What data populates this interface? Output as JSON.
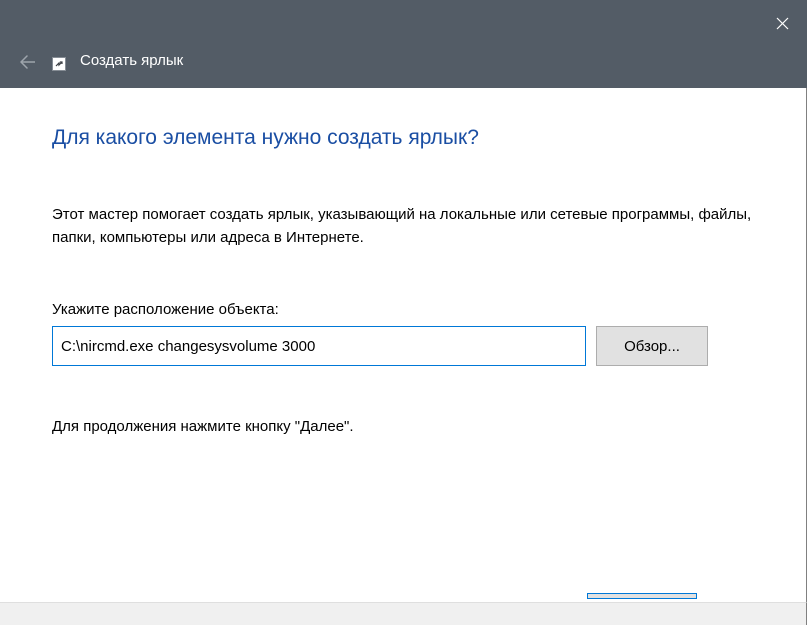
{
  "titlebar": {
    "title": "Создать ярлык"
  },
  "main": {
    "heading": "Для какого элемента нужно создать ярлык?",
    "description": "Этот мастер помогает создать ярлык, указывающий на локальные или сетевые программы, файлы, папки, компьютеры или адреса в Интернете.",
    "field_label": "Укажите расположение объекта:",
    "path_value": "C:\\nircmd.exe changesysvolume 3000",
    "browse_label": "Обзор...",
    "continue_text": "Для продолжения нажмите кнопку \"Далее\"."
  }
}
